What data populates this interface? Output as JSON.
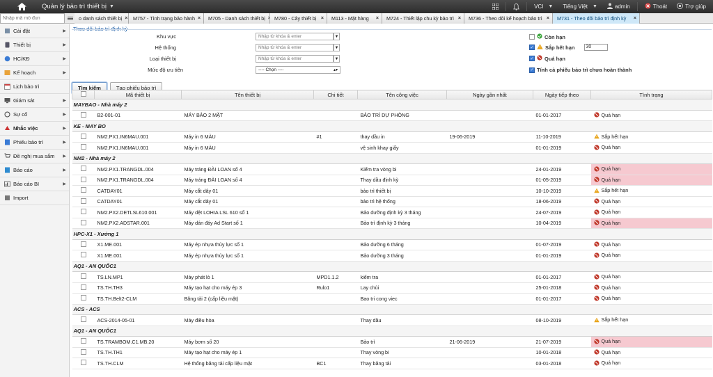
{
  "header": {
    "app_title": "Quản lý bảo trì thiết bị",
    "company": "VCI",
    "language": "Tiếng Việt",
    "user": "admin",
    "logout": "Thoát",
    "help": "Trợ giúp"
  },
  "search": {
    "placeholder": "Nhập mã mô đun"
  },
  "tabs": [
    {
      "label": "o danh sách thiết bị"
    },
    {
      "label": "M757 - Tình trạng bảo hành"
    },
    {
      "label": "M705 - Danh sách thiết bị"
    },
    {
      "label": "M780 - Cây thiết bị"
    },
    {
      "label": "M113 - Mặt hàng"
    },
    {
      "label": "M724 - Thiết lập chu kỳ bảo trì"
    },
    {
      "label": "M736 - Theo dõi kế hoạch bảo trì"
    },
    {
      "label": "M731 - Theo dõi bảo trì định kỳ"
    }
  ],
  "sidebar": {
    "items": [
      {
        "label": "Cài đặt"
      },
      {
        "label": "Thiết bị"
      },
      {
        "label": "HC/KĐ"
      },
      {
        "label": "Kế hoạch"
      },
      {
        "label": "Lịch bảo trì"
      },
      {
        "label": "Giám sát"
      },
      {
        "label": "Sự cố"
      },
      {
        "label": "Nhắc việc"
      },
      {
        "label": "Phiếu bảo trì"
      },
      {
        "label": "Đề nghị mua sắm"
      },
      {
        "label": "Báo cáo"
      },
      {
        "label": "Báo cáo BI"
      },
      {
        "label": "Import"
      }
    ]
  },
  "filters": {
    "section_title": "Theo dõi bảo trì định kỳ",
    "area_label": "Khu vực",
    "system_label": "Hệ thống",
    "type_label": "Loại thiết bị",
    "priority_label": "Mức độ ưu tiên",
    "input_placeholder": "Nhập từ khóa & enter",
    "priority_value": "---- Chọn ----",
    "cb_con_han": "Còn hạn",
    "cb_sap_het_han": "Sắp hết hạn",
    "days_value": "30",
    "cb_qua_han": "Quá hạn",
    "cb_incomplete": "Tính cả phiếu bảo trì chưa hoàn thành",
    "search_button": "Tìm kiếm",
    "create_button": "Tạo phiếu bảo trì"
  },
  "table": {
    "headers": [
      "Mã thiết bị",
      "Tên thiết bị",
      "Chi tiết",
      "Tên công việc",
      "Ngày gần nhất",
      "Ngày tiếp theo",
      "Tình trạng"
    ],
    "rows": [
      {
        "group": "MAYBAO - Nhà máy 2"
      },
      {
        "code": "B2-001-01",
        "name": "MÁY BẢO 2 MẶT",
        "detail": "",
        "job": "BẢO TRÌ DỰ PHÒNG",
        "last": "",
        "next": "01-01-2017",
        "status": "Quá hạn",
        "kind": "over",
        "hl": false
      },
      {
        "group": "KE - MAY BO"
      },
      {
        "code": "NM2.PX1.IN6MAU.001",
        "name": "Máy in 6 MÀU",
        "detail": "#1",
        "job": "thay dầu in",
        "last": "19-06-2019",
        "next": "11-10-2019",
        "status": "Sắp hết hạn",
        "kind": "warn",
        "hl": false
      },
      {
        "code": "NM2.PX1.IN6MAU.001",
        "name": "Máy in 6 MÀU",
        "detail": "",
        "job": "vệ sinh khay giấy",
        "last": "",
        "next": "01-01-2019",
        "status": "Quá hạn",
        "kind": "over",
        "hl": false
      },
      {
        "group": "NM2 - Nhà máy 2"
      },
      {
        "code": "NM2.PX1.TRANGDL.004",
        "name": "Máy tráng ĐÀI LOAN số 4",
        "detail": "",
        "job": "Kiểm tra vòng bi",
        "last": "",
        "next": "24-01-2019",
        "status": "Quá hạn",
        "kind": "over",
        "hl": true
      },
      {
        "code": "NM2.PX1.TRANGDL.004",
        "name": "Máy tráng ĐÀI LOAN số 4",
        "detail": "",
        "job": "Thay dầu định kỳ",
        "last": "",
        "next": "01-05-2019",
        "status": "Quá hạn",
        "kind": "over",
        "hl": true
      },
      {
        "code": "CATDAY01",
        "name": "Máy cắt dây 01",
        "detail": "",
        "job": "bảo trì thiết bị",
        "last": "",
        "next": "10-10-2019",
        "status": "Sắp hết hạn",
        "kind": "warn",
        "hl": false
      },
      {
        "code": "CATDAY01",
        "name": "Máy cắt dây 01",
        "detail": "",
        "job": "bảo trì hệ thống",
        "last": "",
        "next": "18-06-2019",
        "status": "Quá hạn",
        "kind": "over",
        "hl": false
      },
      {
        "code": "NM2.PX2.DETLSL610.001",
        "name": "Máy dệt LOHIA LSL 610 số 1",
        "detail": "",
        "job": "Bảo dưỡng định kỳ 3 tháng",
        "last": "",
        "next": "24-07-2019",
        "status": "Quá hạn",
        "kind": "over",
        "hl": false
      },
      {
        "code": "NM2.PX2.ADSTAR.001",
        "name": "Máy dán đáy Ad Start số 1",
        "detail": "",
        "job": "Bảo trì định kỳ 3 tháng",
        "last": "",
        "next": "10-04-2019",
        "status": "Quá hạn",
        "kind": "over",
        "hl": true
      },
      {
        "group": "HPC-X1 - Xưởng 1"
      },
      {
        "code": "X1.ME.001",
        "name": "Máy ép nhựa thủy lực số 1",
        "detail": "",
        "job": "Bảo dưỡng 6 tháng",
        "last": "",
        "next": "01-07-2019",
        "status": "Quá hạn",
        "kind": "over",
        "hl": false
      },
      {
        "code": "X1.ME.001",
        "name": "Máy ép nhựa thủy lực số 1",
        "detail": "",
        "job": "Bảo dưỡng 3 tháng",
        "last": "",
        "next": "01-01-2019",
        "status": "Quá hạn",
        "kind": "over",
        "hl": false
      },
      {
        "group": "AQ1 - AN QUỐC1"
      },
      {
        "code": "TS.LN.MP1",
        "name": "Máy phát lò 1",
        "detail": "MPD1.1.2",
        "job": "kiểm tra",
        "last": "",
        "next": "01-01-2017",
        "status": "Quá hạn",
        "kind": "over",
        "hl": false
      },
      {
        "code": "TS.TH.TH3",
        "name": "Máy tạo hạt cho máy ép 3",
        "detail": "Rulo1",
        "job": "Lay chùi",
        "last": "",
        "next": "25-01-2018",
        "status": "Quá hạn",
        "kind": "over",
        "hl": false
      },
      {
        "code": "TS.TH.Belt2-CLM",
        "name": "Băng tải 2 (cấp liệu mặt)",
        "detail": "",
        "job": "Bao tri cong viec",
        "last": "",
        "next": "01-01-2017",
        "status": "Quá hạn",
        "kind": "over",
        "hl": false
      },
      {
        "group": "ACS - ACS"
      },
      {
        "code": "ACS-2014-05-01",
        "name": "Máy điều hòa",
        "detail": "",
        "job": "Thay dầu",
        "last": "",
        "next": "08-10-2019",
        "status": "Sắp hết hạn",
        "kind": "warn",
        "hl": false
      },
      {
        "group": "AQ1 - AN QUỐC1"
      },
      {
        "code": "TS.TRAMBOM.C1.MB.20",
        "name": "Máy bơm số 20",
        "detail": "",
        "job": "Bảo trì",
        "last": "21-06-2019",
        "next": "21-07-2019",
        "status": "Quá hạn",
        "kind": "over",
        "hl": true
      },
      {
        "code": "TS.TH.TH1",
        "name": "Máy tạo hạt cho máy ép 1",
        "detail": "",
        "job": "Thay vòng bi",
        "last": "",
        "next": "10-01-2018",
        "status": "Quá hạn",
        "kind": "over",
        "hl": false
      },
      {
        "code": "TS.TH.CLM",
        "name": "Hệ thống băng tải cấp liệu mặt",
        "detail": "BC1",
        "job": "Thay băng tải",
        "last": "",
        "next": "03-01-2018",
        "status": "Quá hạn",
        "kind": "over",
        "hl": false
      }
    ]
  },
  "colors": {
    "overdue_bg": "#f6c9d0",
    "accent": "#1f5fa8",
    "ok": "#3aa53a",
    "warn": "#e8a317",
    "over": "#c0392b"
  }
}
